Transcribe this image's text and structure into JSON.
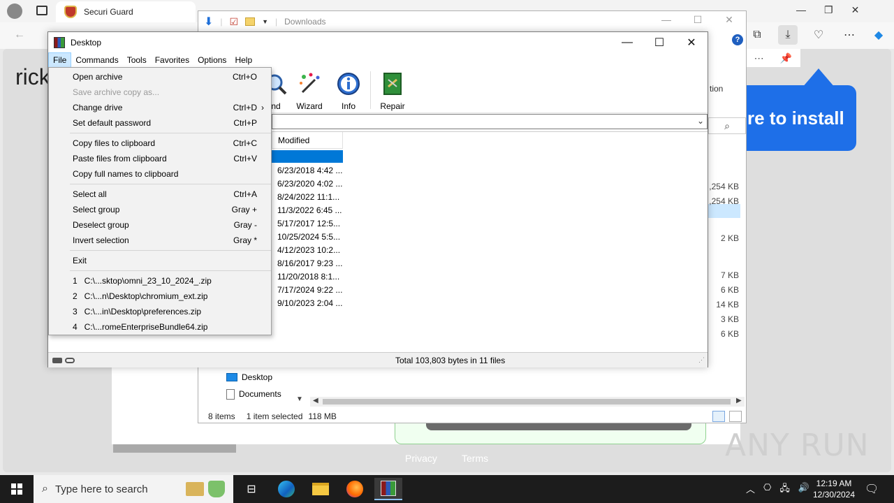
{
  "browser": {
    "tab_title": "Securi Guard",
    "page_text_fragment": "rick",
    "install_bubble_text": "re to install",
    "footer_links": [
      "Privacy",
      "Terms"
    ],
    "watermark": "ANY RUN"
  },
  "downloads_window": {
    "title": "Downloads",
    "partial_toolbar_label": "tion",
    "sizes": [
      ",254 KB",
      ",254 KB",
      "2 KB",
      "7 KB",
      "6 KB",
      "14 KB",
      "3 KB",
      "6 KB"
    ],
    "nav_items": [
      "Desktop",
      "Documents"
    ],
    "status": {
      "items": "8 items",
      "selected": "1 item selected",
      "size": "118 MB"
    }
  },
  "winrar": {
    "title": "Desktop",
    "menu": [
      "File",
      "Commands",
      "Tools",
      "Favorites",
      "Options",
      "Help"
    ],
    "toolbar": [
      {
        "label": "nd",
        "icon": "find-magnifier-icon"
      },
      {
        "label": "Wizard",
        "icon": "wizard-wand-icon"
      },
      {
        "label": "Info",
        "icon": "info-icon"
      },
      {
        "label": "Repair",
        "icon": "repair-book-icon"
      }
    ],
    "column_header": "Modified",
    "modified_dates": [
      "6/23/2018 4:42 ...",
      "6/23/2020 4:02 ...",
      "8/24/2022 11:1...",
      "11/3/2022 6:45 ...",
      "5/17/2017 12:5...",
      "10/25/2024 5:5...",
      "4/12/2023 10:2...",
      "8/16/2017 9:23 ...",
      "11/20/2018 8:1...",
      "7/17/2024 9:22 ...",
      "9/10/2023 2:04 ..."
    ],
    "status_text": "Total 103,803 bytes in 11 files"
  },
  "file_menu": {
    "groups": [
      [
        {
          "label": "Open archive",
          "shortcut": "Ctrl+O",
          "disabled": false
        },
        {
          "label": "Save archive copy as...",
          "shortcut": "",
          "disabled": true
        },
        {
          "label": "Change drive",
          "shortcut": "Ctrl+D",
          "disabled": false,
          "submenu": "›"
        },
        {
          "label": "Set default password",
          "shortcut": "Ctrl+P",
          "disabled": false
        }
      ],
      [
        {
          "label": "Copy files to clipboard",
          "shortcut": "Ctrl+C",
          "disabled": false
        },
        {
          "label": "Paste files from clipboard",
          "shortcut": "Ctrl+V",
          "disabled": false
        },
        {
          "label": "Copy full names to clipboard",
          "shortcut": "",
          "disabled": false
        }
      ],
      [
        {
          "label": "Select all",
          "shortcut": "Ctrl+A",
          "disabled": false
        },
        {
          "label": "Select group",
          "shortcut": "Gray +",
          "disabled": false
        },
        {
          "label": "Deselect group",
          "shortcut": "Gray -",
          "disabled": false
        },
        {
          "label": "Invert selection",
          "shortcut": "Gray *",
          "disabled": false
        }
      ],
      [
        {
          "label": "Exit",
          "shortcut": "",
          "disabled": false
        }
      ],
      [
        {
          "label": "1   C:\\...sktop\\omni_23_10_2024_.zip",
          "shortcut": "",
          "disabled": false
        },
        {
          "label": "2   C:\\...n\\Desktop\\chromium_ext.zip",
          "shortcut": "",
          "disabled": false
        },
        {
          "label": "3   C:\\...in\\Desktop\\preferences.zip",
          "shortcut": "",
          "disabled": false
        },
        {
          "label": "4   C:\\...romeEnterpriseBundle64.zip",
          "shortcut": "",
          "disabled": false
        }
      ]
    ]
  },
  "taskbar": {
    "search_placeholder": "Type here to search",
    "time": "12:19 AM",
    "date": "12/30/2024"
  }
}
